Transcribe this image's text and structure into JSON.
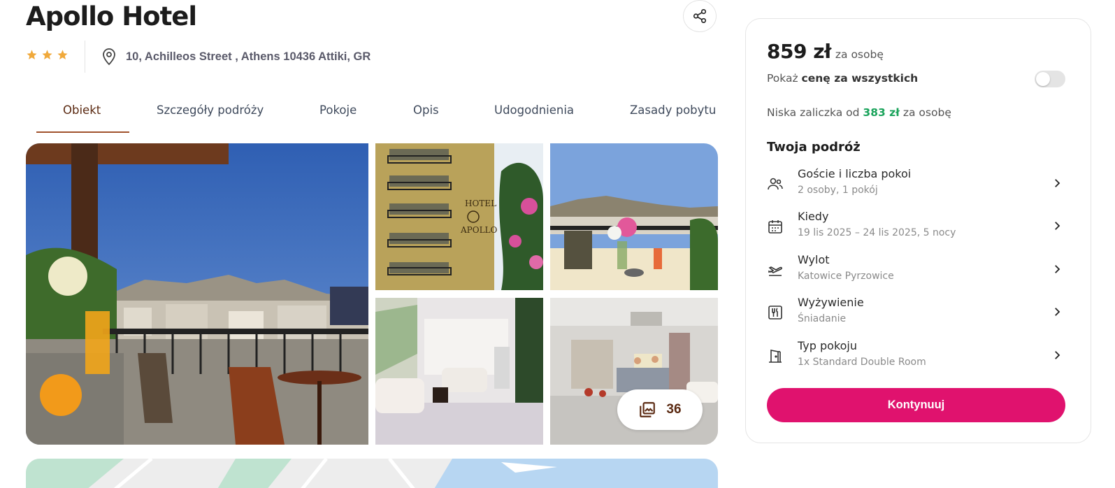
{
  "hotel": {
    "name": "Apollo Hotel",
    "stars": 3,
    "address": "10, Achilleos Street , Athens 10436 Attiki, GR"
  },
  "tabs": [
    {
      "label": "Obiekt",
      "active": true
    },
    {
      "label": "Szczegóły podróży",
      "active": false
    },
    {
      "label": "Pokoje",
      "active": false
    },
    {
      "label": "Opis",
      "active": false
    },
    {
      "label": "Udogodnienia",
      "active": false
    },
    {
      "label": "Zasady pobytu",
      "active": false
    }
  ],
  "gallery": {
    "photo_count": "36",
    "photo_icon": "photo-library-icon"
  },
  "booking": {
    "price": "859 zł",
    "per_person": "za osobę",
    "show_total_prefix": "Pokaż ",
    "show_total_bold": "cenę za wszystkich",
    "show_total_toggle_on": false,
    "deposit_prefix": "Niska zaliczka od",
    "deposit_amount": "383 zł",
    "deposit_suffix": "za osobę",
    "trip_title": "Twoja podróż",
    "trip_items": [
      {
        "icon": "guests-icon",
        "label": "Goście i liczba pokoi",
        "value": "2 osoby, 1 pokój"
      },
      {
        "icon": "calendar-icon",
        "label": "Kiedy",
        "value": "19 lis 2025 – 24 lis 2025, 5 nocy"
      },
      {
        "icon": "plane-departure-icon",
        "label": "Wylot",
        "value": "Katowice Pyrzowice"
      },
      {
        "icon": "meal-icon",
        "label": "Wyżywienie",
        "value": "Śniadanie"
      },
      {
        "icon": "room-door-icon",
        "label": "Typ pokoju",
        "value": "1x Standard Double Room"
      }
    ],
    "continue_label": "Kontynuuj"
  },
  "colors": {
    "accent_brown": "#5b2a12",
    "tab_underline": "#a0522d",
    "star": "#f0a93b",
    "deposit_green": "#1aa35b",
    "cta_pink": "#e0126e"
  }
}
